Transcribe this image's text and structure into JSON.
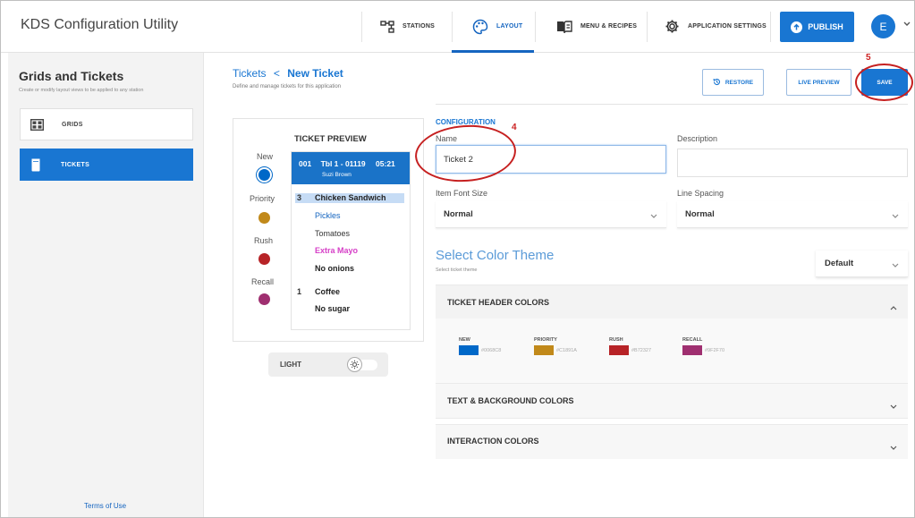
{
  "app": {
    "title": "KDS Configuration Utility"
  },
  "nav": {
    "stations": "STATIONS",
    "layout": "LAYOUT",
    "menu_recipes": "MENU & RECIPES",
    "app_settings": "APPLICATION SETTINGS",
    "publish": "PUBLISH",
    "avatar_initial": "E"
  },
  "sidebar": {
    "title": "Grids and Tickets",
    "subtitle": "Create or modify layout views to be applied to any station",
    "items": [
      {
        "label": "GRIDS",
        "icon": "grid-icon",
        "selected": false
      },
      {
        "label": "TICKETS",
        "icon": "ticket-icon",
        "selected": true
      }
    ],
    "footer_link": "Terms of Use"
  },
  "header": {
    "breadcrumb_parent": "Tickets",
    "breadcrumb_separator": "<",
    "breadcrumb_current": "New Ticket",
    "subtitle": "Define and manage tickets for this application",
    "restore": "RESTORE",
    "live_preview": "LIVE PREVIEW",
    "save": "SAVE"
  },
  "preview": {
    "title": "TICKET PREVIEW",
    "states": [
      {
        "label": "New",
        "color": "#0068C8"
      },
      {
        "label": "Priority",
        "color": "#C1891A"
      },
      {
        "label": "Rush",
        "color": "#B72327"
      },
      {
        "label": "Recall",
        "color": "#9F2F70"
      }
    ],
    "ticket": {
      "number": "001",
      "table": "Tbl 1 - 01119",
      "time": "05:21",
      "server": "Suzi Brown",
      "items": [
        {
          "qty": "3",
          "text": "Chicken Sandwich",
          "style": "item-highlight"
        },
        {
          "qty": "",
          "text": "Pickles",
          "style": "mod-blue"
        },
        {
          "qty": "",
          "text": "Tomatoes",
          "style": "mod-plain"
        },
        {
          "qty": "",
          "text": "Extra Mayo",
          "style": "mod-pink"
        },
        {
          "qty": "",
          "text": "No onions",
          "style": "mod-bold"
        },
        {
          "qty": "1",
          "text": "Coffee",
          "style": "item"
        },
        {
          "qty": "",
          "text": "No sugar",
          "style": "mod-bold"
        }
      ]
    },
    "toggle_label": "LIGHT"
  },
  "config": {
    "title": "CONFIGURATION",
    "name_label": "Name",
    "name_value": "Ticket 2",
    "description_label": "Description",
    "description_value": "",
    "font_size_label": "Item Font Size",
    "font_size_value": "Normal",
    "line_spacing_label": "Line Spacing",
    "line_spacing_value": "Normal",
    "theme_title": "Select Color Theme",
    "theme_subtitle": "Select ticket theme",
    "theme_value": "Default"
  },
  "sections": {
    "header_colors": {
      "title": "TICKET HEADER COLORS",
      "expanded": true,
      "swatches": [
        {
          "label": "NEW",
          "hex": "#0068C8"
        },
        {
          "label": "PRIORITY",
          "hex": "#C1891A"
        },
        {
          "label": "RUSH",
          "hex": "#B72327"
        },
        {
          "label": "RECALL",
          "hex": "#9F2F70"
        }
      ]
    },
    "text_bg": {
      "title": "TEXT & BACKGROUND COLORS",
      "expanded": false
    },
    "interaction": {
      "title": "INTERACTION COLORS",
      "expanded": false
    }
  },
  "annotations": {
    "step4": "4",
    "step5": "5"
  },
  "colors": {
    "accent": "#1976d2",
    "sidebar_bg": "#f3f3f3",
    "annotation": "#c62020"
  }
}
